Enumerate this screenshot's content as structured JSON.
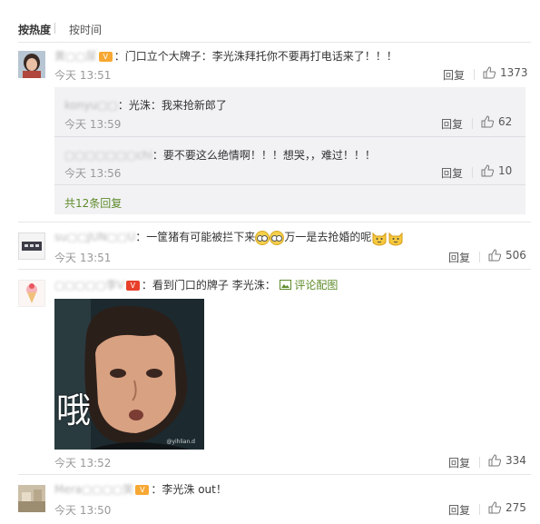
{
  "sort": {
    "hot": "按热度",
    "time": "按时间"
  },
  "icons": {
    "like": "thumb-up-icon",
    "picture": "picture-icon",
    "vip": "vip-badge-icon",
    "emoji_glasses": "emoji-glasses",
    "emoji_cat": "emoji-cat"
  },
  "colors": {
    "username": "#eb7350",
    "link": "#5d8b2a",
    "text": "#333333",
    "meta": "#999999"
  },
  "comments": [
    {
      "user": "黄▢▢尿",
      "text": "：门口立个大牌子：李光洙拜托你不要再打电话来了！！！",
      "time": "今天 13:51",
      "reply": "回复",
      "likes": "1373",
      "replies": [
        {
          "user": "konyu▢▢",
          "text": "：光洙：我来抢新郎了",
          "time": "今天 13:59",
          "reply": "回复",
          "likes": "62"
        },
        {
          "user": "▢▢▢▢▢▢▢chi",
          "text": "：要不要这么绝情啊！！！想哭，，难过！！！",
          "time": "今天 13:56",
          "reply": "回复",
          "likes": "10"
        }
      ],
      "more": "共12条回复"
    },
    {
      "user": "su▢▢JUN▢▢U",
      "text_before": "：一筐猪有可能被拦下来",
      "text_after": "万一是去抢婚的呢",
      "time": "今天 13:51",
      "reply": "回复",
      "likes": "506"
    },
    {
      "user": "▢▢▢▢▢李V",
      "text": "：看到门口的牌子 李光洙：",
      "link": "评论配图",
      "photo_caption": "哦",
      "photo_watermark": "@yihlian.d",
      "time": "今天 13:52",
      "reply": "回复",
      "likes": "334"
    },
    {
      "user": "Mera▢▢▢▢笑",
      "text": "：李光洙 out！",
      "time": "今天 13:50",
      "reply": "回复",
      "likes": "275"
    }
  ]
}
